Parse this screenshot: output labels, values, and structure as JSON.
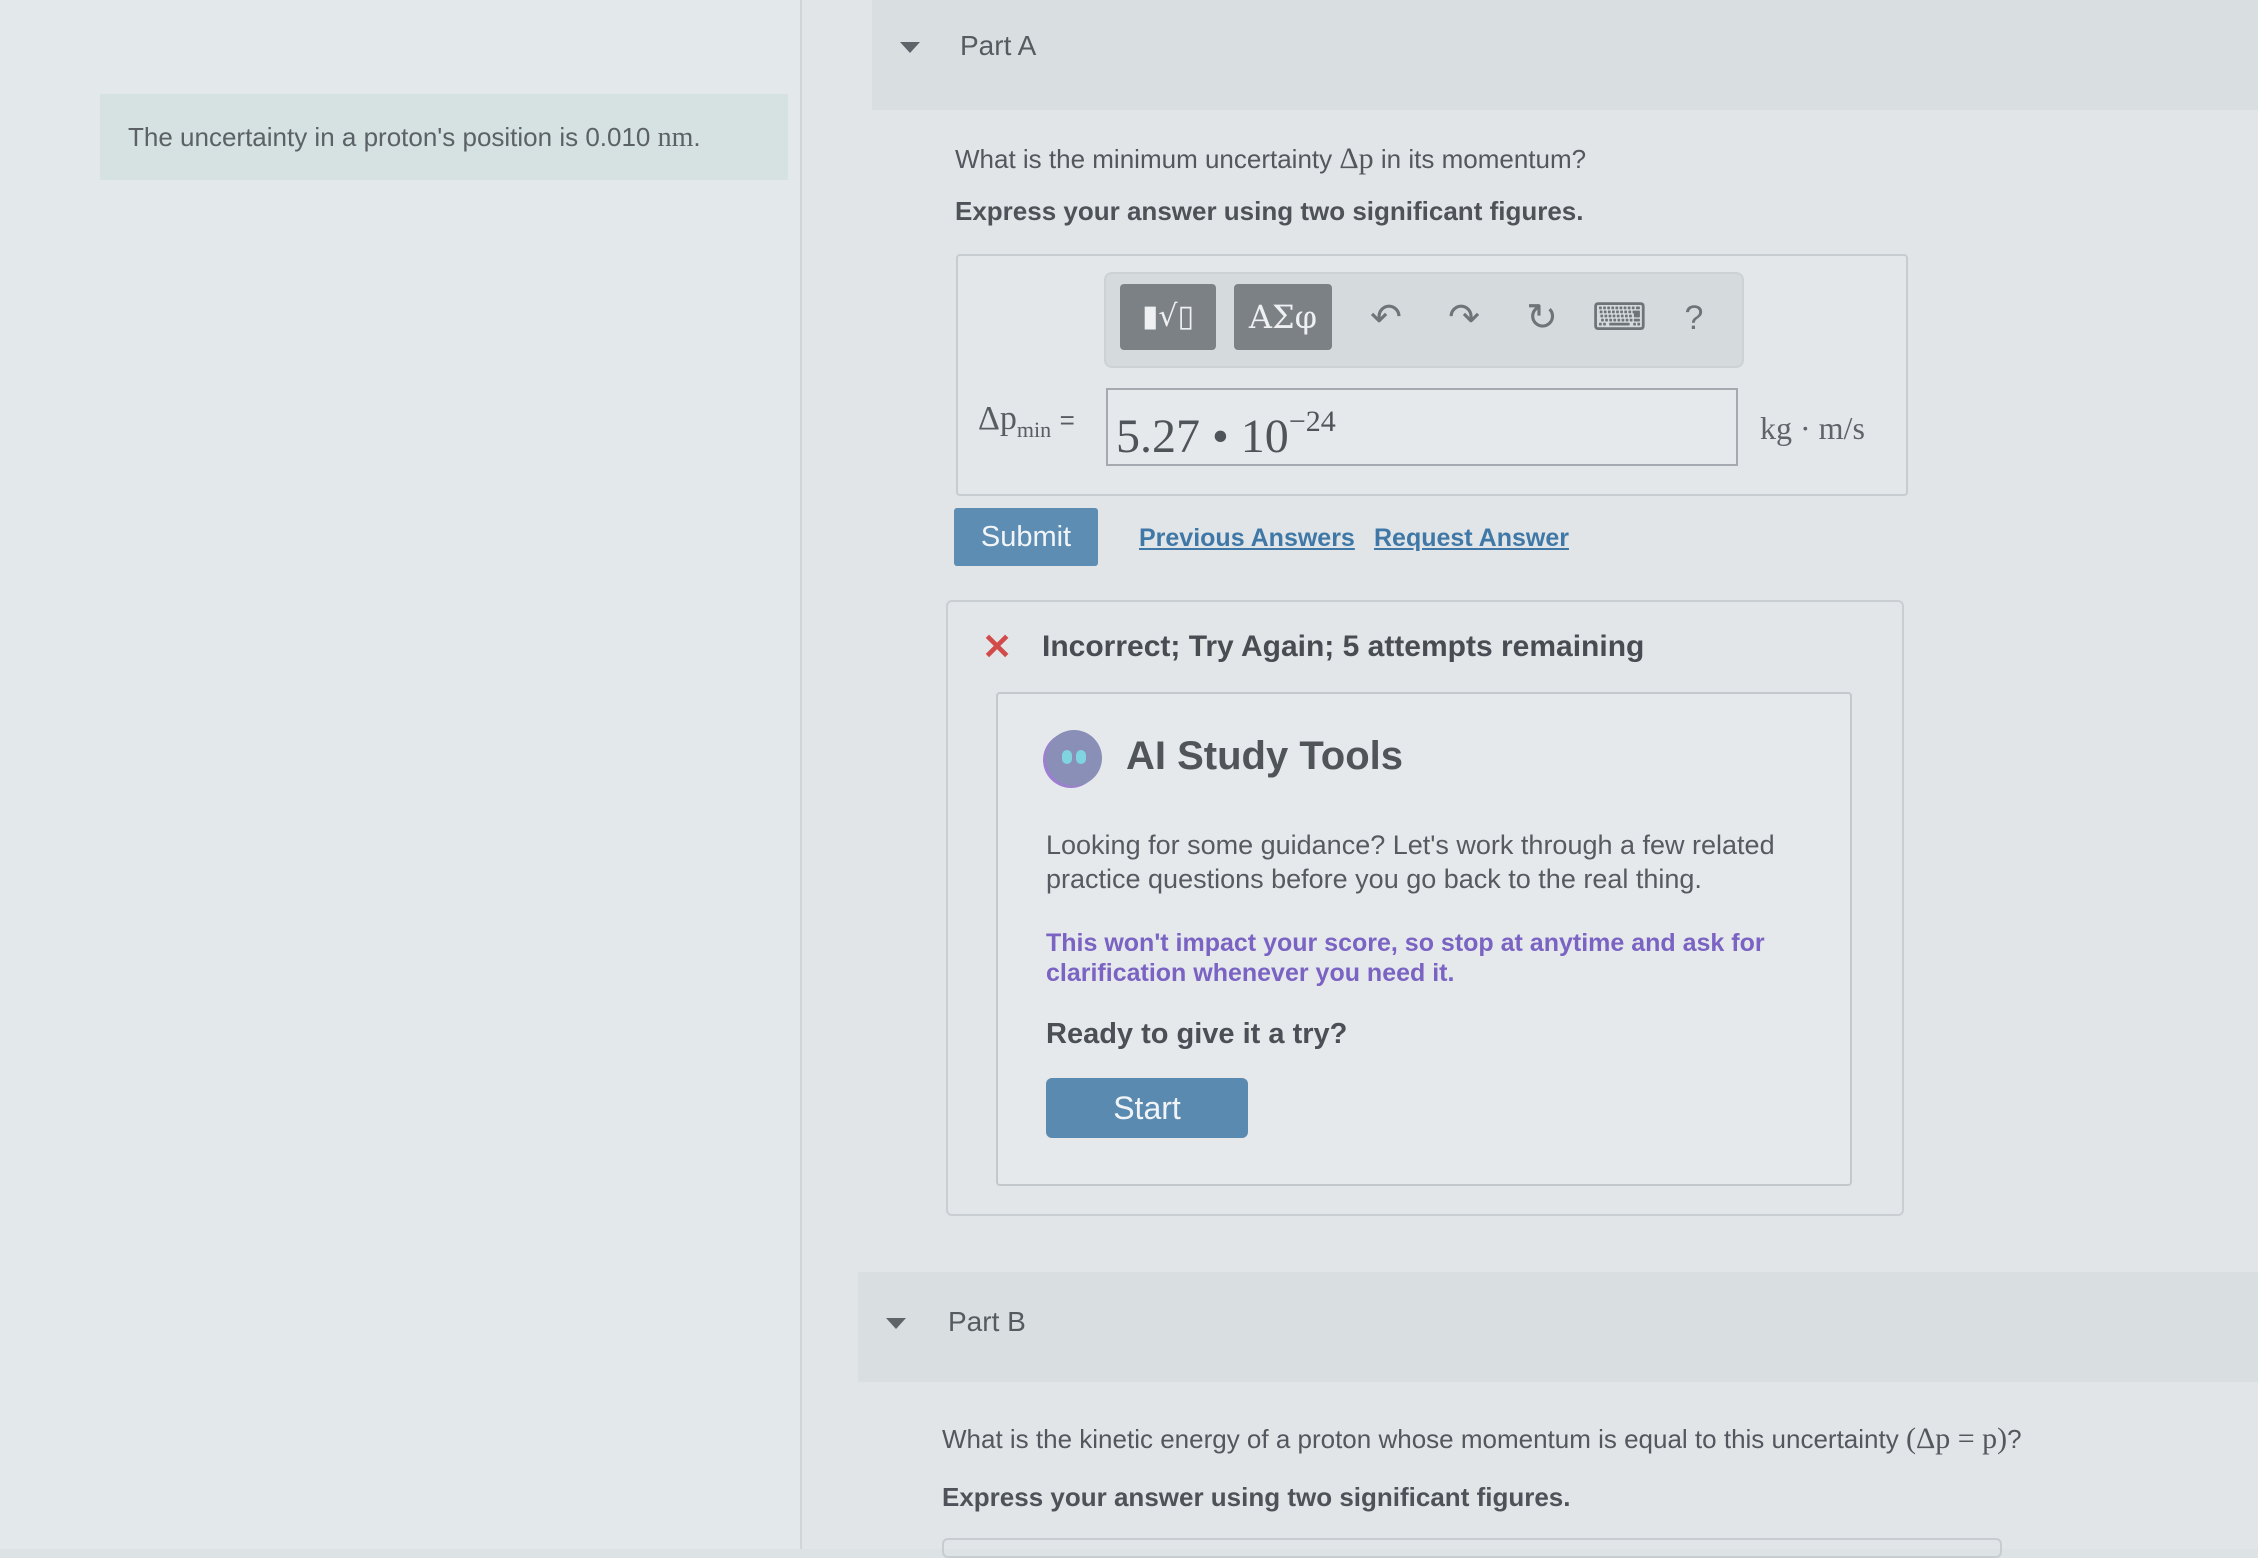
{
  "problem": {
    "intro_prefix": "The uncertainty in a proton's position is 0.010",
    "intro_unit": "nm",
    "intro_suffix": "."
  },
  "part_a": {
    "title": "Part A",
    "question_prefix": "What is the minimum uncertainty",
    "question_symbol": "Δp",
    "question_suffix": "in its momentum?",
    "instruction": "Express your answer using two significant figures.",
    "toolbar": {
      "templates_icon": "▮√▯",
      "greek_label": "ΑΣφ",
      "undo_icon": "↶",
      "redo_icon": "↷",
      "reset_icon": "↻",
      "keyboard_icon": "⌨",
      "help_icon": "?"
    },
    "variable": "Δp",
    "variable_sub": "min",
    "equals": "=",
    "answer_mantissa": "5.27 • 10",
    "answer_exponent": "−24",
    "unit": "kg · m/s",
    "submit_label": "Submit",
    "previous_answers_label": "Previous Answers",
    "request_answer_label": "Request Answer",
    "feedback": {
      "icon": "✕",
      "message": "Incorrect; Try Again; 5 attempts remaining"
    },
    "ai_tools": {
      "title": "AI Study Tools",
      "description": "Looking for some guidance? Let's work through a few related practice questions before you go back to the real thing.",
      "note": "This won't impact your score, so stop at anytime and ask for clarification whenever you need it.",
      "ready": "Ready to give it a try?",
      "start_label": "Start"
    }
  },
  "part_b": {
    "title": "Part B",
    "question_prefix": "What is the kinetic energy of a proton whose momentum is equal to this uncertainty",
    "question_math": "(Δp = p)",
    "question_suffix": "?",
    "instruction": "Express your answer using two significant figures."
  },
  "colors": {
    "accent": "#5d8db3",
    "link": "#3f78a6",
    "error": "#d24b4b",
    "ai_note": "#7a63c2"
  }
}
